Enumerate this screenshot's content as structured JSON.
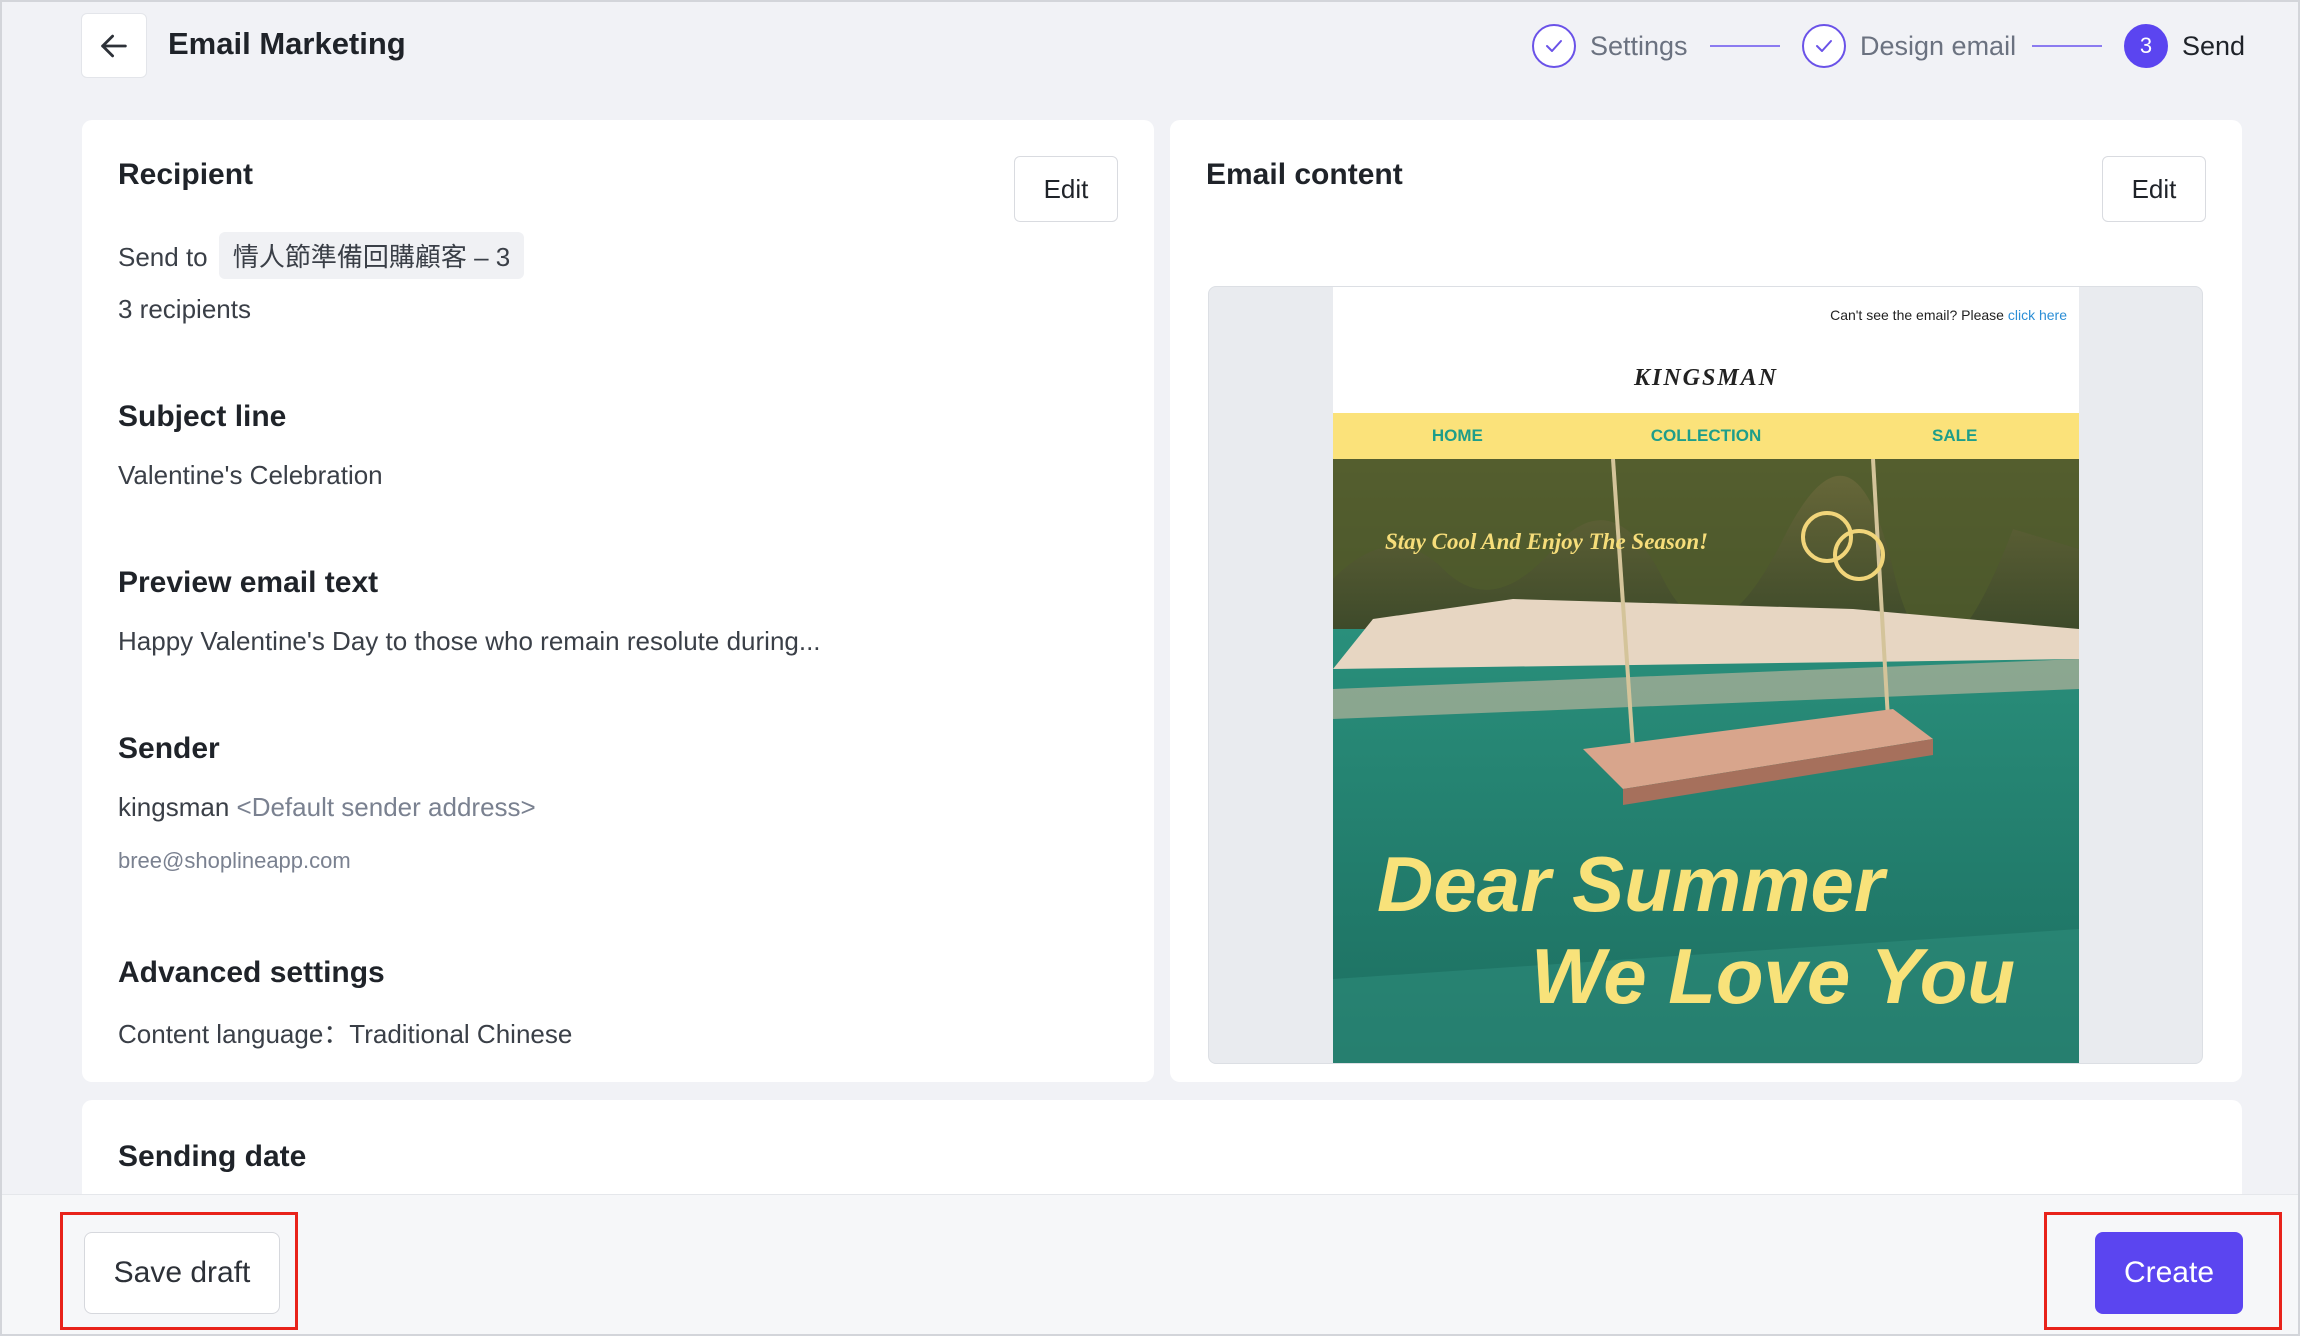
{
  "header": {
    "title": "Email Marketing",
    "steps": [
      {
        "label": "Settings",
        "state": "done"
      },
      {
        "label": "Design email",
        "state": "done"
      },
      {
        "label": "Send",
        "number": "3",
        "state": "active"
      }
    ]
  },
  "recipient": {
    "title": "Recipient",
    "edit_label": "Edit",
    "send_to_label": "Send to",
    "segment": "情人節準備回購顧客 – 3",
    "count_text": "3 recipients"
  },
  "subject": {
    "title": "Subject line",
    "value": "Valentine's Celebration"
  },
  "preview_text": {
    "title": "Preview email text",
    "value": "Happy Valentine's Day to those who remain resolute during..."
  },
  "sender": {
    "title": "Sender",
    "name": "kingsman",
    "note": "<Default sender address>",
    "email": "bree@shoplineapp.com"
  },
  "advanced": {
    "title": "Advanced settings",
    "language_text": "Content language：Traditional Chinese"
  },
  "email_content": {
    "title": "Email content",
    "edit_label": "Edit",
    "preview": {
      "top_text": "Can't see the email? Please",
      "top_link": "click here",
      "brand": "KINGSMAN",
      "nav": [
        "HOME",
        "COLLECTION",
        "SALE"
      ],
      "tagline": "Stay Cool And Enjoy The Season!",
      "headline_1": "Dear Summer",
      "headline_2": "We Love You"
    }
  },
  "sending_date": {
    "title": "Sending date"
  },
  "footer": {
    "save_draft_label": "Save draft",
    "create_label": "Create"
  },
  "colors": {
    "accent": "#5b45f0",
    "highlight": "#e8231b",
    "nav_bg": "#fbe27a",
    "nav_text": "#1e9e8a",
    "hero_text": "#f8e27a"
  }
}
